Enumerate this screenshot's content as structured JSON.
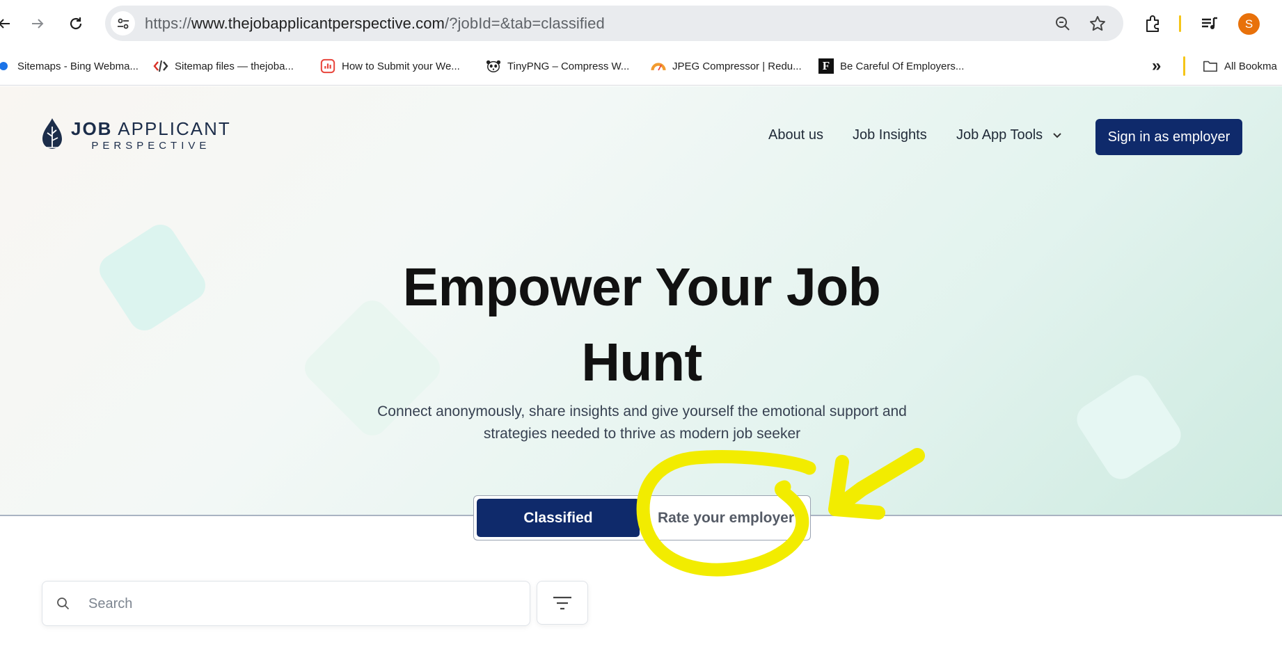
{
  "browser": {
    "url_scheme": "https://",
    "url_host": "www.thejobapplicantperspective.com",
    "url_rest": "/?jobId=&tab=classified",
    "profile_initial": "S",
    "icons": [
      "back-arrow-icon",
      "forward-arrow-icon",
      "reload-icon",
      "site-info-icon",
      "zoom-icon",
      "star-icon",
      "extensions-icon",
      "media-control-icon"
    ]
  },
  "bookmarks": {
    "items": [
      {
        "label": "Sitemaps - Bing Webma...",
        "icon": "bing-icon"
      },
      {
        "label": "Sitemap files — thejoba...",
        "icon": "code-icon"
      },
      {
        "label": "How to Submit your We...",
        "icon": "chart-icon"
      },
      {
        "label": "TinyPNG – Compress W...",
        "icon": "panda-icon"
      },
      {
        "label": "JPEG Compressor | Redu...",
        "icon": "gauge-icon"
      },
      {
        "label": "Be Careful Of Employers...",
        "icon": "forbes-icon"
      }
    ],
    "overflow_label": "»",
    "all_bookmarks_label": "All Bookma"
  },
  "site": {
    "logo_line1_bold": "JOB",
    "logo_line1_rest": "APPLICANT",
    "logo_line2": "PERSPECTIVE",
    "nav": {
      "about": "About us",
      "insights": "Job Insights",
      "tools": "Job App Tools",
      "signin": "Sign in as employer"
    },
    "hero": {
      "title_line1": "Empower Your Job",
      "title_line2": "Hunt",
      "subtitle_line1": "Connect anonymously, share insights and give yourself the emotional support and",
      "subtitle_line2": "strategies needed to thrive as modern job seeker"
    },
    "tabs": {
      "classified": "Classified",
      "rate": "Rate your employer",
      "active": "Classified"
    },
    "search": {
      "placeholder": "Search",
      "value": ""
    }
  },
  "colors": {
    "brand_navy": "#0f2a6b",
    "annotation_yellow": "#f2ec00",
    "avatar_orange": "#e8710a"
  }
}
